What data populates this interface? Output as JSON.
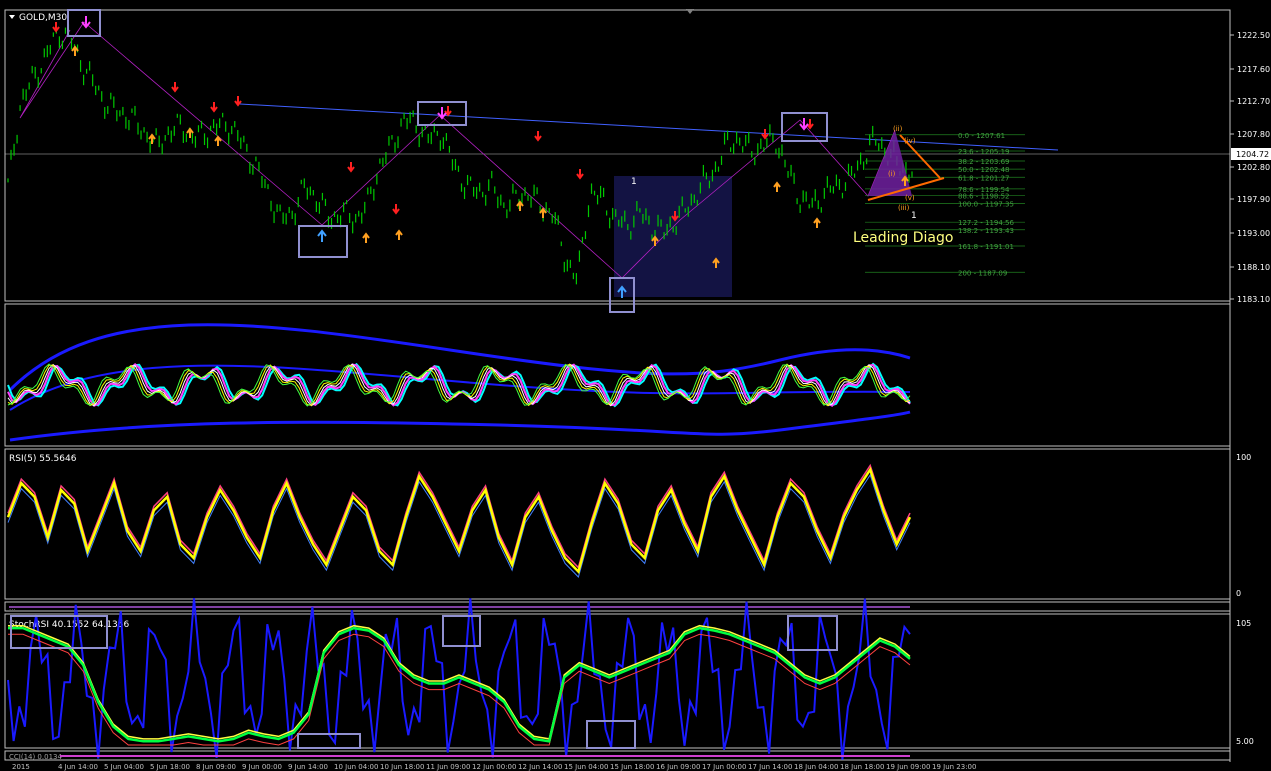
{
  "window": {
    "symbol_label": "GOLD,M30"
  },
  "price_axis": {
    "ticks": [
      "1222.50",
      "1217.60",
      "1212.70",
      "1207.80",
      "1202.80",
      "1197.90",
      "1193.00",
      "1188.10",
      "1183.10"
    ],
    "current_price": "1204.72"
  },
  "fibonacci": {
    "levels": [
      "0.0 - 1207.61",
      "23.6 - 1205.19",
      "38.2 - 1203.69",
      "50.0 - 1202.48",
      "61.8 - 1201.27",
      "78.6 - 1199.54",
      "88.6 - 1198.52",
      "100.0 - 1197.35",
      "127.2 - 1194.56",
      "138.2 - 1193.43",
      "161.8 - 1191.01",
      "200 - 1187.09"
    ]
  },
  "annotations": {
    "pattern_text": "Leading Diago",
    "wave_i": "(i)",
    "wave_ii": "(ii)",
    "wave_iii": "(iii)",
    "wave_iv": "(iv)",
    "wave_v": "(v)",
    "wave_1": "1",
    "label_1_center": "1"
  },
  "rsi_pane": {
    "label": "RSI(5) 55.5646",
    "top_tick": "100",
    "bottom_tick": "0"
  },
  "stoch_pane": {
    "label": "StochRSI 40.1552 64.1356",
    "top_tick": "105",
    "bottom_tick": "5.00"
  },
  "thin_pane": {
    "label": "..."
  },
  "bottom_pane": {
    "label": "CCI(14) 0.0134"
  },
  "time_axis": {
    "labels": [
      "2015",
      "4 Jun 14:00",
      "5 Jun 04:00",
      "5 Jun 18:00",
      "8 Jun 09:00",
      "9 Jun 00:00",
      "9 Jun 14:00",
      "10 Jun 04:00",
      "10 Jun 18:00",
      "11 Jun 09:00",
      "12 Jun 00:00",
      "12 Jun 14:00",
      "15 Jun 04:00",
      "15 Jun 18:00",
      "16 Jun 09:00",
      "17 Jun 00:00",
      "17 Jun 14:00",
      "18 Jun 04:00",
      "18 Jun 18:00",
      "19 Jun 09:00",
      "19 Jun 23:00"
    ]
  },
  "colors": {
    "candle": "#00c800",
    "sell_arrow": "#ff2020",
    "buy_arrow": "#ffa020",
    "zigzag": "#b020c0",
    "trendline": "#4060ff",
    "highlight_box": "#9090d0",
    "rsi_main": "#ffff00",
    "stoch_fast": "#00ff40",
    "band": "#1a1aff"
  },
  "chart_data": {
    "type": "line",
    "title": "GOLD,M30",
    "ylabel": "",
    "ylim": [
      1183.1,
      1222.5
    ],
    "series": [
      {
        "values": [
          1200,
          1212,
          1216,
          1219,
          1223,
          1222,
          1218,
          1215,
          1212,
          1211,
          1210,
          1208,
          1206,
          1208,
          1209,
          1207,
          1208,
          1209,
          1209,
          1206,
          1203,
          1199,
          1195,
          1196,
          1200,
          1198,
          1195,
          1196,
          1195,
          1197,
          1203,
          1206,
          1210,
          1209,
          1207,
          1208,
          1203,
          1200,
          1199,
          1200,
          1197,
          1198,
          1199,
          1197,
          1196,
          1189,
          1186,
          1199,
          1198,
          1195,
          1194,
          1196,
          1194,
          1193,
          1195,
          1197,
          1200,
          1202,
          1206,
          1207,
          1205,
          1206,
          1207,
          1202,
          1198,
          1197,
          1199,
          1200,
          1201,
          1204,
          1207,
          1205,
          1203,
          1202
        ]
      }
    ],
    "annotated_levels": {
      "fib_0": 1207.61,
      "fib_23_6": 1205.19,
      "fib_38_2": 1203.69,
      "fib_50": 1202.48,
      "fib_61_8": 1201.27,
      "fib_78_6": 1199.54,
      "fib_88_6": 1198.52,
      "fib_100": 1197.35,
      "fib_127_2": 1194.56,
      "fib_138_2": 1193.43,
      "fib_161_8": 1191.01,
      "fib_200": 1187.09
    },
    "rsi_series": {
      "ylim": [
        0,
        100
      ],
      "values": [
        55,
        80,
        70,
        40,
        75,
        65,
        30,
        55,
        80,
        45,
        30,
        60,
        70,
        35,
        25,
        55,
        75,
        60,
        40,
        25,
        60,
        80,
        55,
        35,
        20,
        45,
        70,
        60,
        30,
        20,
        55,
        85,
        70,
        50,
        30,
        60,
        75,
        40,
        20,
        55,
        70,
        45,
        25,
        15,
        50,
        80,
        65,
        35,
        25,
        60,
        75,
        50,
        30,
        70,
        85,
        60,
        40,
        20,
        55,
        80,
        70,
        45,
        25,
        55,
        75,
        90,
        60,
        35,
        55
      ]
    },
    "stoch_series": {
      "ylim": [
        5,
        105
      ],
      "values": [
        100,
        100,
        95,
        90,
        85,
        70,
        40,
        20,
        10,
        8,
        8,
        10,
        12,
        10,
        8,
        10,
        15,
        12,
        10,
        15,
        30,
        80,
        95,
        100,
        98,
        90,
        70,
        60,
        55,
        55,
        60,
        55,
        50,
        40,
        20,
        10,
        8,
        60,
        70,
        65,
        60,
        65,
        70,
        75,
        80,
        95,
        100,
        98,
        95,
        90,
        85,
        80,
        70,
        60,
        55,
        60,
        70,
        80,
        90,
        85,
        75
      ]
    }
  }
}
